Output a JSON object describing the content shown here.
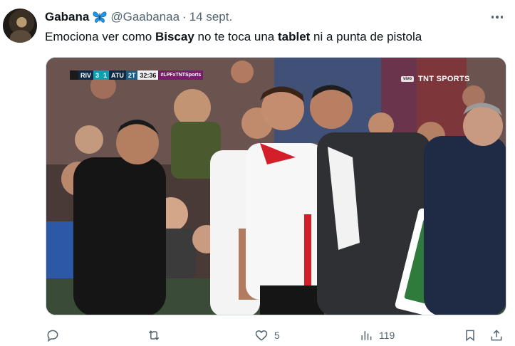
{
  "tweet": {
    "author_name": "Gabana",
    "author_handle": "@Gaabanaa",
    "separator": "·",
    "date": "14 sept.",
    "text_parts": {
      "t1": "Emociona ver como ",
      "b1": "Biscay",
      "t2": " no te toca una ",
      "b2": "tablet",
      "t3": " ni a punta de pistola"
    }
  },
  "media": {
    "scorebug": {
      "home_team": "RIV",
      "home_score": "3",
      "away_score": "1",
      "away_team": "ATU",
      "half": "2T",
      "clock": "32:36",
      "hashtag": "#LPFxTNTSports"
    },
    "broadcaster": {
      "badge": "vivo",
      "name": "TNT SPORTS"
    }
  },
  "actions": {
    "reply_count": "",
    "retweet_count": "",
    "like_count": "5",
    "views_count": "119"
  },
  "colors": {
    "text": "#0f1419",
    "secondary": "#536471",
    "border": "#cfd9de",
    "butterfly": "#1d9bf0"
  },
  "icons": [
    "avatar",
    "butterfly-emoji-icon",
    "more-options-icon",
    "reply-icon",
    "retweet-icon",
    "like-icon",
    "views-icon",
    "bookmark-icon",
    "share-icon"
  ]
}
